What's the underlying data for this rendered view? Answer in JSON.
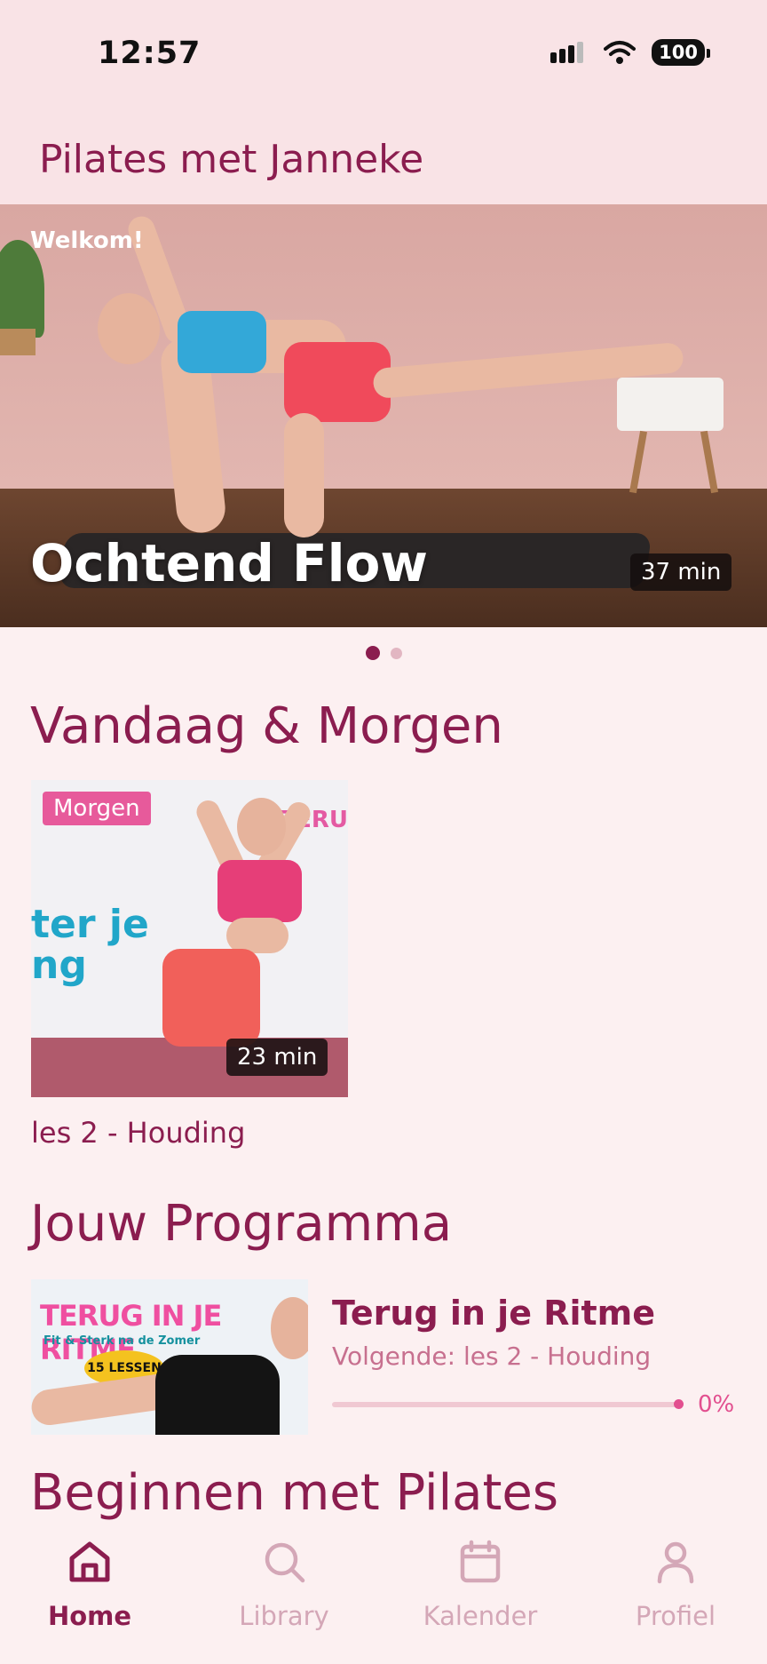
{
  "status_bar": {
    "time": "12:57",
    "battery": "100"
  },
  "header": {
    "title": "Pilates met Janneke"
  },
  "hero": {
    "greeting": "Welkom!",
    "title": "Ochtend Flow",
    "duration": "37 min",
    "carousel": {
      "active_index": 0,
      "count": 2
    }
  },
  "sections": {
    "today": {
      "title": "Vandaag & Morgen",
      "cards": [
        {
          "badge": "Morgen",
          "duration": "23 min",
          "caption": "les 2 - Houding",
          "thumb_text": "ter je\nng",
          "thumb_side_text": "TERU"
        }
      ]
    },
    "program": {
      "title": "Jouw Programma",
      "thumb": {
        "title": "TERUG IN JE RITME",
        "subtitle": "Fit & Sterk na de Zomer",
        "lessons": "15 LESSEN"
      },
      "name": "Terug in je Ritme",
      "next": "Volgende: les 2 - Houding",
      "progress": 0,
      "progress_label": "0%"
    },
    "beginners": {
      "title": "Beginnen met Pilates"
    }
  },
  "tab_bar": {
    "items": [
      {
        "label": "Home",
        "icon": "home-icon",
        "active": true
      },
      {
        "label": "Library",
        "icon": "search-icon",
        "active": false
      },
      {
        "label": "Kalender",
        "icon": "calendar-icon",
        "active": false
      },
      {
        "label": "Profiel",
        "icon": "profile-icon",
        "active": false
      }
    ]
  },
  "colors": {
    "accent": "#8b1d4f",
    "pink": "#e75a9b",
    "background": "#fcf0f1"
  }
}
